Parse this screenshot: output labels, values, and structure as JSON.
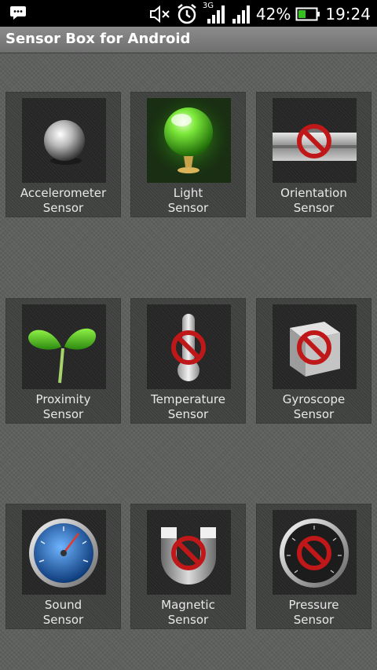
{
  "status_bar": {
    "network_label": "3G",
    "battery_percent": "42%",
    "battery_level": 0.42,
    "time": "19:24",
    "icons": [
      "chat-icon",
      "mute-icon",
      "alarm-icon",
      "signal-icon",
      "battery-icon"
    ]
  },
  "app": {
    "title": "Sensor Box for Android"
  },
  "sensors": [
    {
      "line1": "Accelerometer",
      "line2": "Sensor",
      "icon": "metal-ball-icon",
      "available": true
    },
    {
      "line1": "Light",
      "line2": "Sensor",
      "icon": "green-light-bulb-icon",
      "available": true
    },
    {
      "line1": "Orientation",
      "line2": "Sensor",
      "icon": "level-tube-icon",
      "available": false
    },
    {
      "line1": "Proximity",
      "line2": "Sensor",
      "icon": "sprout-icon",
      "available": true
    },
    {
      "line1": "Temperature",
      "line2": "Sensor",
      "icon": "thermometer-icon",
      "available": false
    },
    {
      "line1": "Gyroscope",
      "line2": "Sensor",
      "icon": "cube-icon",
      "available": false
    },
    {
      "line1": "Sound",
      "line2": "Sensor",
      "icon": "sound-meter-icon",
      "available": true
    },
    {
      "line1": "Magnetic",
      "line2": "Sensor",
      "icon": "magnet-icon",
      "available": false
    },
    {
      "line1": "Pressure",
      "line2": "Sensor",
      "icon": "pressure-gauge-icon",
      "available": false
    }
  ],
  "colors": {
    "unavailable": "#c01818",
    "light_green": "#3fbf1f",
    "gauge_blue": "#1f5ea8"
  }
}
